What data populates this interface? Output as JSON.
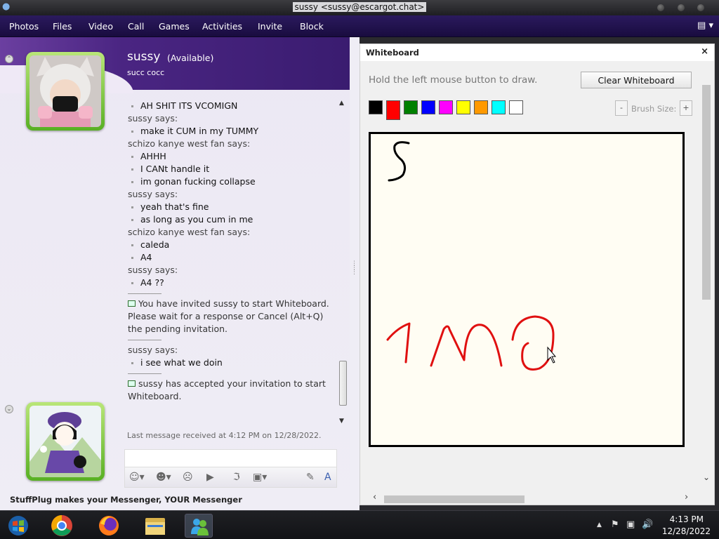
{
  "window": {
    "title": "sussy <sussy@escargot.chat>"
  },
  "menu": {
    "items": [
      "Photos",
      "Files",
      "Video",
      "Call",
      "Games",
      "Activities",
      "Invite",
      "Block"
    ]
  },
  "contact": {
    "name": "sussy",
    "status": "(Available)",
    "personal_message": "succ cocc"
  },
  "chat": {
    "blocks": [
      {
        "lines": [
          "AH SHIT ITS VCOMIGN"
        ]
      },
      {
        "says": "sussy says:",
        "lines": [
          "make it CUM in my TUMMY"
        ]
      },
      {
        "says": "schizo kanye west fan says:",
        "lines": [
          "AHHH",
          "I CANt handle it",
          "im gonan fucking collapse"
        ]
      },
      {
        "says": "sussy says:",
        "lines": [
          "yeah that's fine",
          "as long as you cum in me"
        ]
      },
      {
        "says": "schizo kanye west fan says:",
        "lines": [
          "caleda",
          "A4"
        ]
      },
      {
        "says": "sussy says:",
        "lines": [
          "A4 ??"
        ]
      }
    ],
    "invite_notice": "You have invited sussy to start Whiteboard. Please wait for a response or Cancel (Alt+Q) the pending invitation.",
    "after_invite_says": "sussy says:",
    "after_invite_line": "i see what we doin",
    "accept_notice": "sussy has accepted your invitation to start Whiteboard.",
    "last_received": "Last message received at 4:12 PM on 12/28/2022."
  },
  "stuffplug_text": "StuffPlug makes your Messenger, YOUR Messenger",
  "whiteboard": {
    "title": "Whiteboard",
    "close_glyph": "×",
    "hint": "Hold the left mouse button to draw.",
    "clear_label": "Clear Whiteboard",
    "brush_label": "Brush Size: 3",
    "brush_minus": "-",
    "brush_plus": "+",
    "colors": [
      "#000000",
      "#ff0000",
      "#008000",
      "#0000ff",
      "#ff00ff",
      "#ffff00",
      "#ff9900",
      "#00ffff",
      "#ffffff"
    ],
    "selected_color": "#ff0000"
  },
  "taskbar": {
    "time": "4:13 PM",
    "date": "12/28/2022"
  }
}
